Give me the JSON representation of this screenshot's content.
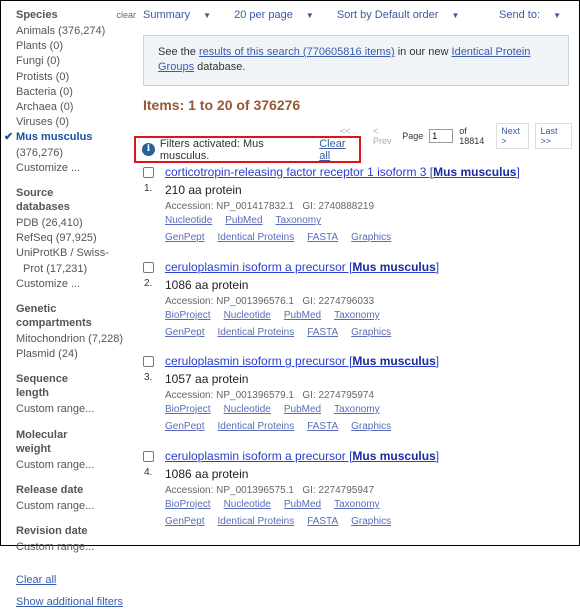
{
  "sidebar": {
    "species": {
      "title": "Species",
      "clear": "clear",
      "items": [
        "Animals (376,274)",
        "Plants (0)",
        "Fungi (0)",
        "Protists (0)",
        "Bacteria (0)",
        "Archaea (0)",
        "Viruses (0)"
      ],
      "selected_name": "Mus musculus",
      "selected_count": " (376,276)",
      "customize": "Customize ..."
    },
    "source": {
      "title": "Source databases",
      "items": [
        "PDB (26,410)",
        "RefSeq (97,925)",
        "UniProtKB / Swiss-"
      ],
      "item_cont": "Prot (17,231)",
      "customize": "Customize ..."
    },
    "genetic": {
      "title": "Genetic compartments",
      "items": [
        "Mitochondrion (7,228)",
        "Plasmid (24)"
      ]
    },
    "seq": {
      "title": "Sequence length",
      "custom": "Custom range..."
    },
    "mw": {
      "title": "Molecular weight",
      "custom": "Custom range..."
    },
    "release": {
      "title": "Release date",
      "custom": "Custom range..."
    },
    "revision": {
      "title": "Revision date",
      "custom": "Custom range..."
    },
    "clear_all": "Clear all",
    "show_additional": "Show additional filters"
  },
  "toolbar": {
    "summary": "Summary",
    "per_page": "20 per page",
    "sort": "Sort by Default order",
    "send_to": "Send to:"
  },
  "notice": {
    "pre": "See the ",
    "link1": "results of this search (770605816 items)",
    "mid": " in our new ",
    "link2": "Identical Protein Groups",
    "post": " database."
  },
  "items_heading": "Items: 1 to 20 of 376276",
  "pager": {
    "first": "<< First",
    "prev": "< Prev",
    "page_label": "Page",
    "page_value": "1",
    "of": "of 18814",
    "next": "Next >",
    "last": "Last >>"
  },
  "filter": {
    "text": "Filters activated: Mus musculus.",
    "clear": "Clear all"
  },
  "results": [
    {
      "num": "1.",
      "title": "corticotropin-releasing factor receptor 1 isoform 3",
      "org": "Mus musculus",
      "length": "210 aa protein",
      "acc": "Accession: NP_001417832.1   GI: 2740888219",
      "links1": [
        "Nucleotide",
        "PubMed",
        "Taxonomy"
      ],
      "links2": [
        "GenPept",
        "Identical Proteins",
        "FASTA",
        "Graphics"
      ]
    },
    {
      "num": "2.",
      "title": "ceruloplasmin isoform a precursor",
      "org": "Mus musculus",
      "length": "1086 aa protein",
      "acc": "Accession: NP_001396576.1   GI: 2274796033",
      "links1": [
        "BioProject",
        "Nucleotide",
        "PubMed",
        "Taxonomy"
      ],
      "links2": [
        "GenPept",
        "Identical Proteins",
        "FASTA",
        "Graphics"
      ]
    },
    {
      "num": "3.",
      "title": "ceruloplasmin isoform g precursor",
      "org": "Mus musculus",
      "length": "1057 aa protein",
      "acc": "Accession: NP_001396579.1   GI: 2274795974",
      "links1": [
        "BioProject",
        "Nucleotide",
        "PubMed",
        "Taxonomy"
      ],
      "links2": [
        "GenPept",
        "Identical Proteins",
        "FASTA",
        "Graphics"
      ]
    },
    {
      "num": "4.",
      "title": "ceruloplasmin isoform a precursor",
      "org": "Mus musculus",
      "length": "1086 aa protein",
      "acc": "Accession: NP_001396575.1   GI: 2274795947",
      "links1": [
        "BioProject",
        "Nucleotide",
        "PubMed",
        "Taxonomy"
      ],
      "links2": [
        "GenPept",
        "Identical Proteins",
        "FASTA",
        "Graphics"
      ]
    }
  ]
}
